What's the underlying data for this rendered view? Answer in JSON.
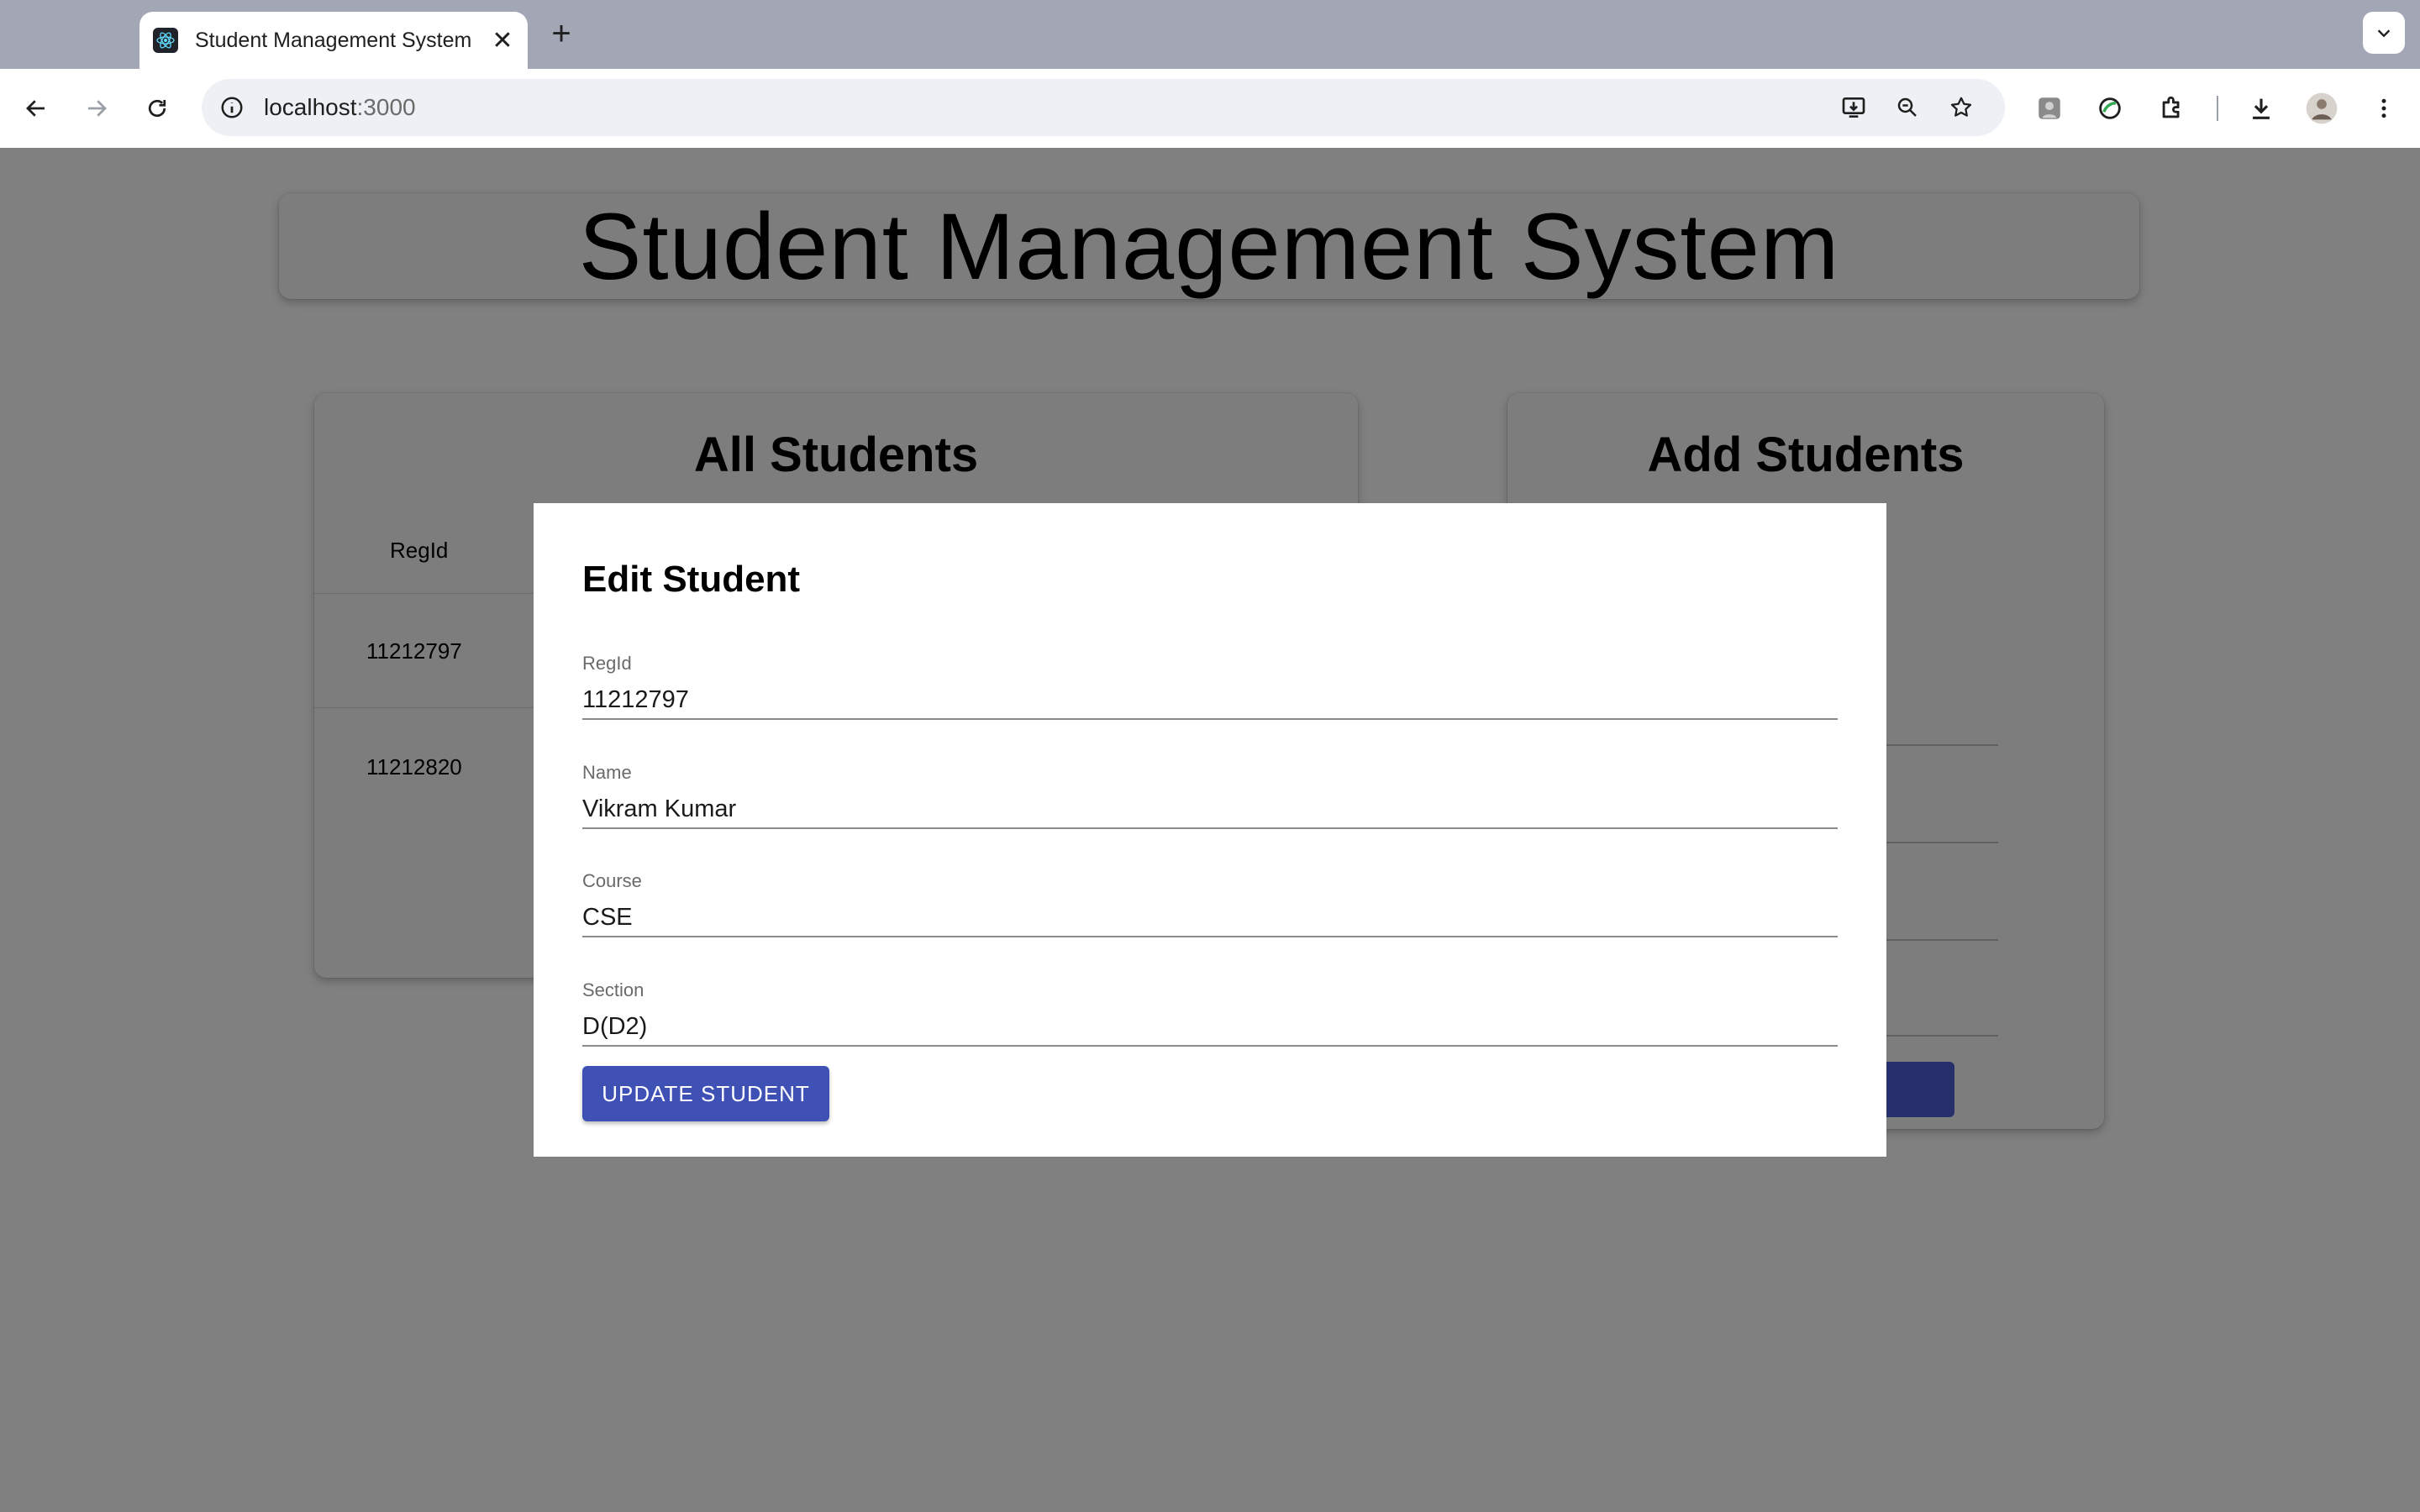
{
  "browser": {
    "tab_title": "Student Management System",
    "url_host": "localhost",
    "url_port": ":3000"
  },
  "page": {
    "title": "Student Management System",
    "all_students": {
      "heading": "All Students",
      "column_header": "RegId",
      "rows": [
        "11212797",
        "11212820"
      ]
    },
    "add_students": {
      "heading": "Add Students"
    }
  },
  "modal": {
    "title": "Edit Student",
    "fields": [
      {
        "label": "RegId",
        "value": "11212797"
      },
      {
        "label": "Name",
        "value": "Vikram Kumar"
      },
      {
        "label": "Course",
        "value": "CSE"
      },
      {
        "label": "Section",
        "value": "D(D2)"
      }
    ],
    "submit_label": "UPDATE STUDENT"
  },
  "colors": {
    "primary": "#3f51b5",
    "overlay": "#808080"
  }
}
